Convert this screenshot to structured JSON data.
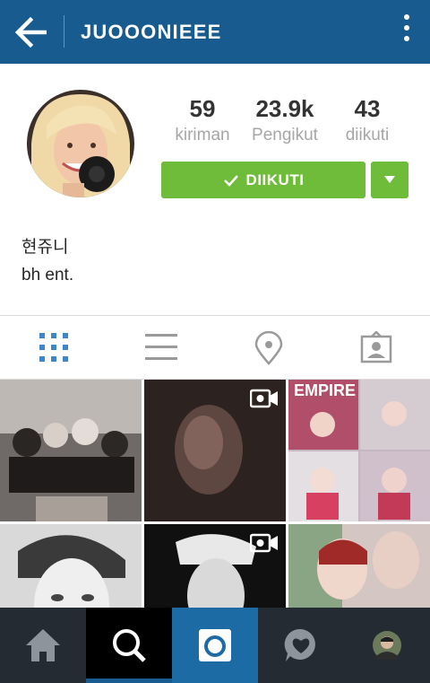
{
  "header": {
    "username": "JUOOONIEEE"
  },
  "stats": [
    {
      "value": "59",
      "label": "kiriman"
    },
    {
      "value": "23.9k",
      "label": "Pengikut"
    },
    {
      "value": "43",
      "label": "diikuti"
    }
  ],
  "follow_button": {
    "label": "DIIKUTI"
  },
  "bio": {
    "name": "현쥬니",
    "text": "bh ent."
  },
  "colors": {
    "header": "#185b8e",
    "follow_green": "#6fbc3b",
    "tab_active": "#3c87c9",
    "bottom_bar": "#252b32"
  },
  "tabs": [
    "grid-icon",
    "list-icon",
    "location-pin-icon",
    "tagged-person-icon"
  ],
  "bottom_nav": [
    "home-icon",
    "search-icon",
    "camera-icon",
    "activity-heart-icon",
    "profile-avatar"
  ]
}
